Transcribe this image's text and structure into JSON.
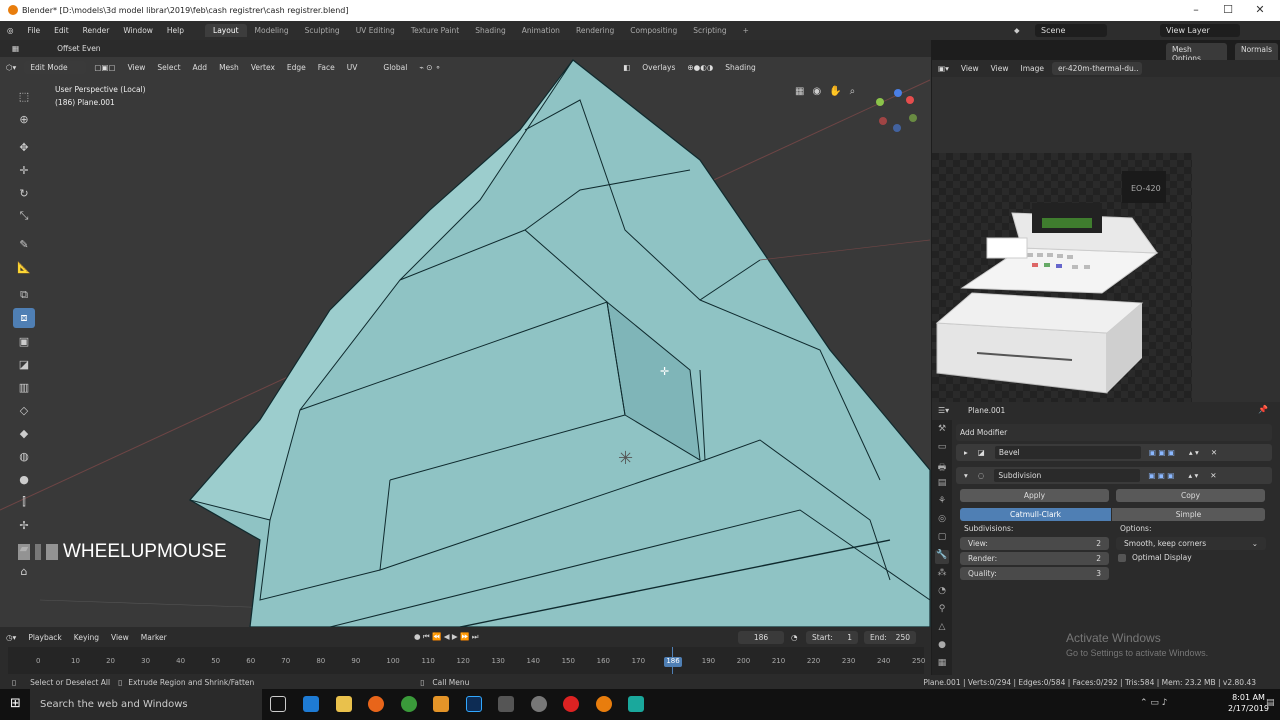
{
  "window": {
    "title": "Blender* [D:\\models\\3d model librar\\2019\\feb\\cash registrer\\cash registrer.blend]"
  },
  "menus": [
    "File",
    "Edit",
    "Render",
    "Window",
    "Help"
  ],
  "workspaces": [
    "Layout",
    "Modeling",
    "Sculpting",
    "UV Editing",
    "Texture Paint",
    "Shading",
    "Animation",
    "Rendering",
    "Compositing",
    "Scripting"
  ],
  "topbar_right": {
    "scene": "Scene",
    "view_layer": "View Layer"
  },
  "viewport": {
    "offset_even": "Offset Even",
    "mode": "Edit Mode",
    "menu": [
      "View",
      "Select",
      "Add",
      "Mesh",
      "Vertex",
      "Edge",
      "Face",
      "UV"
    ],
    "transform_orientation": "Global",
    "overlays": "Overlays",
    "shading": "Shading",
    "mesh_options": "Mesh Options",
    "normals": "Normals",
    "perspective": "User Perspective (Local)",
    "object": "(186) Plane.001",
    "key_overlay": "WHEELUPMOUSE"
  },
  "image_editor": {
    "view": "View",
    "view2": "View",
    "image": "Image",
    "image_name": "er-420m-thermal-du..",
    "display_text": "EO-420"
  },
  "properties": {
    "object_name": "Plane.001",
    "add_modifier": "Add Modifier",
    "modifiers": [
      {
        "name": "Bevel"
      },
      {
        "name": "Subdivision"
      }
    ],
    "apply": "Apply",
    "copy": "Copy",
    "catmull": "Catmull-Clark",
    "simple": "Simple",
    "subdivisions_label": "Subdivisions:",
    "options_label": "Options:",
    "view_label": "View:",
    "view_value": "2",
    "render_label": "Render:",
    "render_value": "2",
    "quality_label": "Quality:",
    "quality_value": "3",
    "uv_smooth": "Smooth, keep corners",
    "optimal_display": "Optimal Display"
  },
  "timeline": {
    "menu": [
      "Playback",
      "Keying",
      "View",
      "Marker"
    ],
    "current_frame": "186",
    "start_label": "Start:",
    "start": "1",
    "end_label": "End:",
    "end": "250",
    "ticks": [
      "0",
      "10",
      "20",
      "30",
      "40",
      "50",
      "60",
      "70",
      "80",
      "90",
      "100",
      "110",
      "120",
      "130",
      "140",
      "150",
      "160",
      "170",
      "180",
      "190",
      "200",
      "210",
      "220",
      "230",
      "240",
      "250"
    ],
    "playhead": "186"
  },
  "statusbar": {
    "left1": "Select or Deselect All",
    "left2": "Extrude Region and Shrink/Fatten",
    "mid": "Call Menu",
    "stats": "Plane.001 | Verts:0/294 | Edges:0/584 | Faces:0/292 | Tris:584 | Mem: 23.2 MB | v2.80.43"
  },
  "activate": {
    "title": "Activate Windows",
    "subtitle": "Go to Settings to activate Windows."
  },
  "taskbar": {
    "search": "Search the web and Windows",
    "time": "8:01 AM",
    "date": "2/17/2019"
  }
}
